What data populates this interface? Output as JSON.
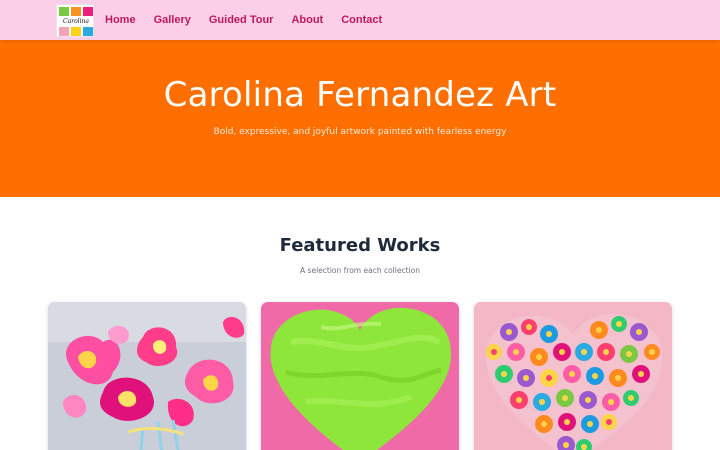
{
  "nav": {
    "logo_text": "Carolina",
    "links": [
      {
        "label": "Home"
      },
      {
        "label": "Gallery"
      },
      {
        "label": "Guided Tour"
      },
      {
        "label": "About"
      },
      {
        "label": "Contact"
      }
    ]
  },
  "hero": {
    "title": "Carolina Fernandez Art",
    "subtitle": "Bold, expressive, and joyful artwork painted with fearless energy"
  },
  "featured": {
    "title": "Featured Works",
    "subtitle": "A selection from each collection",
    "cards": [
      {
        "subject": "pink-flowers-painting"
      },
      {
        "subject": "green-heart-painting"
      },
      {
        "subject": "paper-flower-heart-collage"
      }
    ]
  },
  "colors": {
    "nav_bg": "#fbcfe8",
    "nav_link": "#be185d",
    "hero_bg": "#ff6f00",
    "hero_text": "#ffffff"
  }
}
